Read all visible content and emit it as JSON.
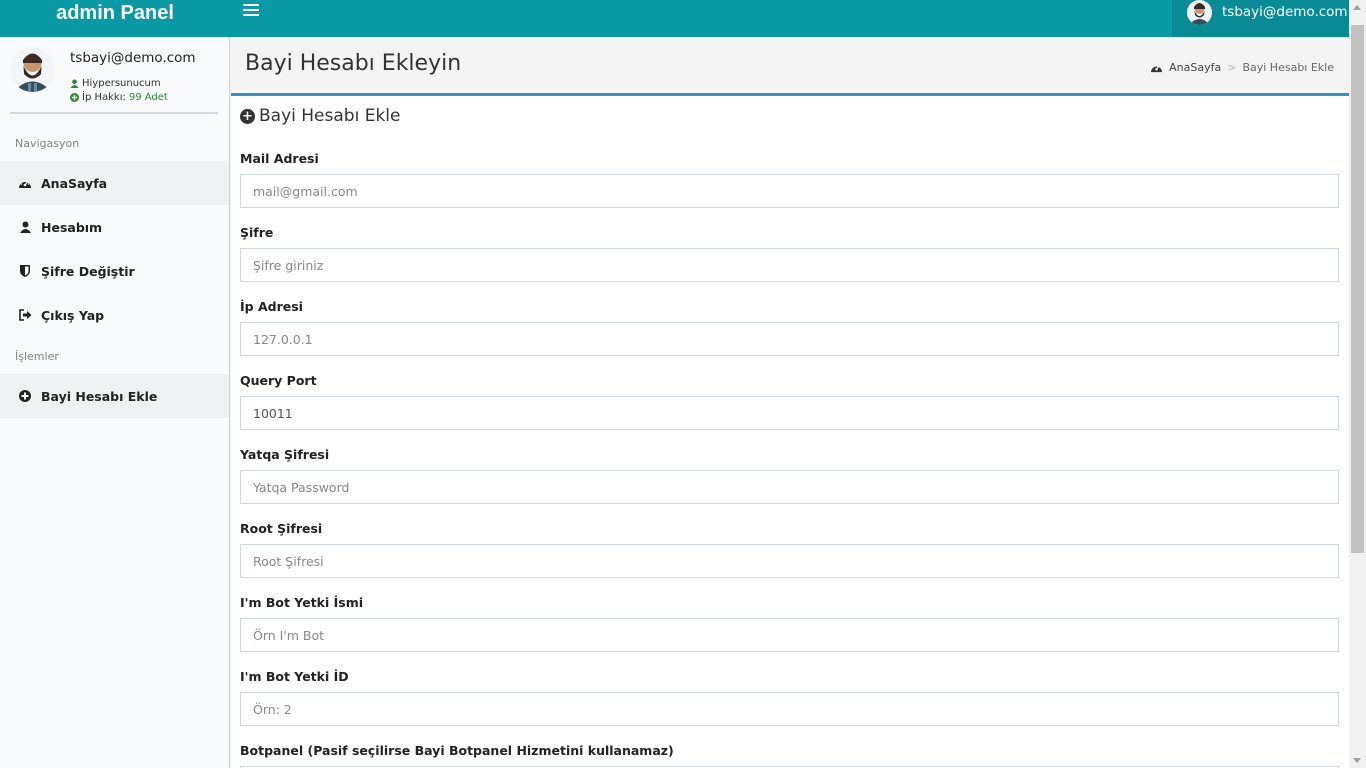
{
  "app": {
    "logo": "admin Panel"
  },
  "topbar": {
    "user": "tsbayi@demo.com"
  },
  "sidebar": {
    "user_name": "tsbayi@demo.com",
    "role": "Hiypersunucum",
    "ip_prefix": "İp Hakkı:",
    "ip_value": "99 Adet",
    "nav_header": "Navigasyon",
    "nav_items": [
      {
        "label": "AnaSayfa",
        "icon": "dashboard-icon"
      },
      {
        "label": "Hesabım",
        "icon": "user-icon"
      },
      {
        "label": "Şifre Değiştir",
        "icon": "shield-icon"
      },
      {
        "label": "Çıkış Yap",
        "icon": "sign-out-icon"
      }
    ],
    "ops_header": "İşlemler",
    "ops_items": [
      {
        "label": "Bayi Hesabı Ekle",
        "icon": "plus-circle-icon"
      }
    ]
  },
  "header": {
    "title": "Bayi Hesabı Ekleyin",
    "breadcrumb": [
      "AnaSayfa",
      "Bayi Hesabı Ekle"
    ]
  },
  "form": {
    "title": "Bayi Hesabı Ekle",
    "fields": [
      {
        "label": "Mail Adresi",
        "placeholder": "mail@gmail.com",
        "value": ""
      },
      {
        "label": "Şifre",
        "placeholder": "Şifre giriniz",
        "value": ""
      },
      {
        "label": "İp Adresi",
        "placeholder": "127.0.0.1",
        "value": ""
      },
      {
        "label": "Query Port",
        "placeholder": "",
        "value": "10011"
      },
      {
        "label": "Yatqa Şifresi",
        "placeholder": "Yatqa Password",
        "value": ""
      },
      {
        "label": "Root Şifresi",
        "placeholder": "Root Şifresi",
        "value": ""
      },
      {
        "label": "I'm Bot Yetki İsmi",
        "placeholder": "Örn I'm Bot",
        "value": ""
      },
      {
        "label": "I'm Bot Yetki İD",
        "placeholder": "Örn: 2",
        "value": ""
      }
    ],
    "botpanel_label": "Botpanel (Pasif seçilirse Bayi Botpanel Hizmetini kullanamaz)"
  },
  "colors": {
    "topbar": "#0a9aa6",
    "accent": "#3c8dbc"
  }
}
